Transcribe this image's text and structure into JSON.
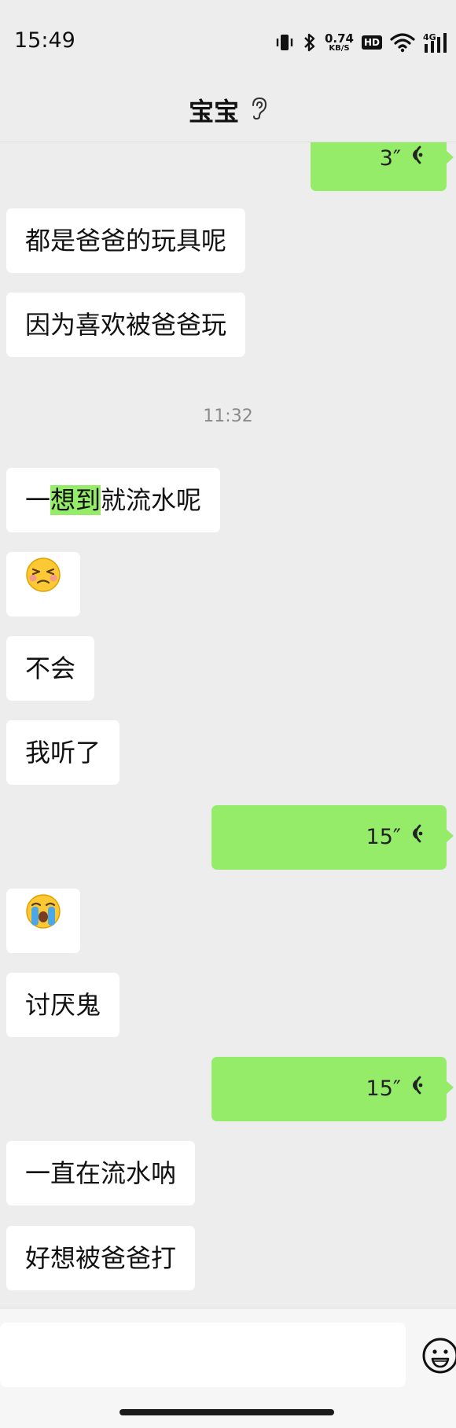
{
  "status_bar": {
    "time": "15:49",
    "net_speed_value": "0.74",
    "net_speed_unit": "KB/S",
    "hd_label": "HD",
    "network_label": "4G"
  },
  "header": {
    "title": "宝宝",
    "title_icon": "ear-icon"
  },
  "messages": [
    {
      "side": "out",
      "type": "voice",
      "duration": "3″"
    },
    {
      "side": "in",
      "type": "text",
      "text": "都是爸爸的玩具呢"
    },
    {
      "side": "in",
      "type": "text",
      "text": "因为喜欢被爸爸玩"
    },
    {
      "type": "timestamp",
      "text": "11:32"
    },
    {
      "side": "in",
      "type": "text",
      "text_parts": [
        "一",
        "想到",
        "就流水呢"
      ],
      "highlighted": "想到"
    },
    {
      "side": "in",
      "type": "emoji",
      "emoji": "😣"
    },
    {
      "side": "in",
      "type": "text",
      "text": "不会"
    },
    {
      "side": "in",
      "type": "text",
      "text": "我听了"
    },
    {
      "side": "out",
      "type": "voice",
      "duration": "15″"
    },
    {
      "side": "in",
      "type": "emoji",
      "emoji": "😭"
    },
    {
      "side": "in",
      "type": "text",
      "text": "讨厌鬼"
    },
    {
      "side": "out",
      "type": "voice",
      "duration": "15″"
    },
    {
      "side": "in",
      "type": "text",
      "text": "一直在流水呐"
    },
    {
      "side": "in",
      "type": "text",
      "text": "好想被爸爸打"
    }
  ],
  "input": {
    "value": "",
    "placeholder": ""
  },
  "colors": {
    "background": "#ededed",
    "outgoing_bubble": "#95ec69",
    "incoming_bubble": "#ffffff",
    "highlight": "#95ec69"
  }
}
